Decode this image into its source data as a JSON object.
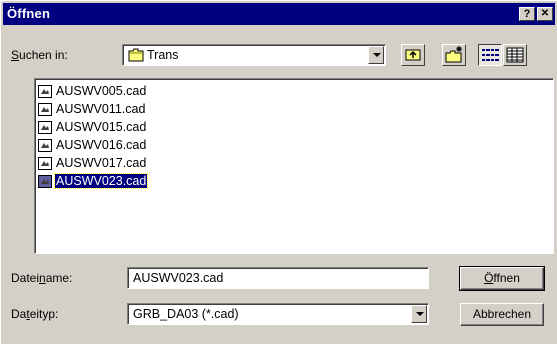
{
  "window": {
    "title": "Öffnen",
    "help_button": "?",
    "close_button": "✕"
  },
  "look_in": {
    "label_pre": "",
    "label_accel": "S",
    "label_post": "uchen in:",
    "value": "Trans",
    "icon": "folder-icon"
  },
  "toolbar": {
    "up_folder": "up-one-level-icon",
    "new_folder": "new-folder-icon",
    "list_view": "list-view-icon",
    "details_view": "details-view-icon"
  },
  "files": [
    {
      "name": "AUSWV005.cad",
      "selected": false
    },
    {
      "name": "AUSWV011.cad",
      "selected": false
    },
    {
      "name": "AUSWV015.cad",
      "selected": false
    },
    {
      "name": "AUSWV016.cad",
      "selected": false
    },
    {
      "name": "AUSWV017.cad",
      "selected": false
    },
    {
      "name": "AUSWV023.cad",
      "selected": true
    }
  ],
  "filename": {
    "label_pre": "Datei",
    "label_accel": "n",
    "label_post": "ame:",
    "value": "AUSWV023.cad"
  },
  "filetype": {
    "label_pre": "Da",
    "label_accel": "t",
    "label_post": "eityp:",
    "value": "GRB_DA03 (*.cad)"
  },
  "buttons": {
    "open_accel": "Ö",
    "open_rest": "ffnen",
    "cancel": "Abbrechen"
  },
  "colors": {
    "titlebar": "#000080",
    "face": "#d4d0c8",
    "selection": "#000080"
  }
}
